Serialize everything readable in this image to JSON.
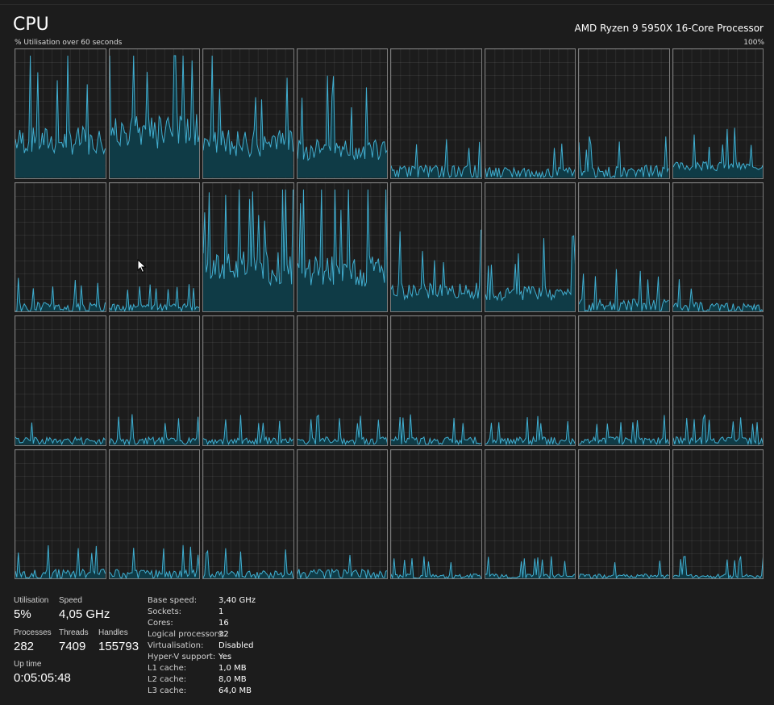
{
  "header": {
    "title": "CPU",
    "processor": "AMD Ryzen 9 5950X 16-Core Processor",
    "graph_label": "% Utilisation over 60 seconds",
    "graph_max": "100%"
  },
  "colors": {
    "background": "#1c1c1c",
    "graph_line": "#41aed0",
    "graph_fill": "#0f3b46",
    "graph_border": "#7b7b7b"
  },
  "cpu_graphs": [
    {
      "level": 0.32
    },
    {
      "level": 0.4
    },
    {
      "level": 0.3
    },
    {
      "level": 0.25
    },
    {
      "level": 0.08
    },
    {
      "level": 0.07
    },
    {
      "level": 0.08
    },
    {
      "level": 0.1
    },
    {
      "level": 0.06
    },
    {
      "level": 0.05
    },
    {
      "level": 0.38
    },
    {
      "level": 0.35
    },
    {
      "level": 0.18
    },
    {
      "level": 0.16
    },
    {
      "level": 0.08
    },
    {
      "level": 0.06
    },
    {
      "level": 0.05
    },
    {
      "level": 0.05
    },
    {
      "level": 0.05
    },
    {
      "level": 0.05
    },
    {
      "level": 0.05
    },
    {
      "level": 0.05
    },
    {
      "level": 0.05
    },
    {
      "level": 0.05
    },
    {
      "level": 0.06
    },
    {
      "level": 0.06
    },
    {
      "level": 0.05
    },
    {
      "level": 0.06
    },
    {
      "level": 0.03
    },
    {
      "level": 0.03
    },
    {
      "level": 0.03
    },
    {
      "level": 0.03
    }
  ],
  "stats": {
    "utilisation": {
      "label": "Utilisation",
      "value": "5%"
    },
    "speed": {
      "label": "Speed",
      "value": "4,05 GHz"
    },
    "processes": {
      "label": "Processes",
      "value": "282"
    },
    "threads": {
      "label": "Threads",
      "value": "7409"
    },
    "handles": {
      "label": "Handles",
      "value": "155793"
    },
    "uptime": {
      "label": "Up time",
      "value": "0:05:05:48"
    }
  },
  "specs": [
    {
      "label": "Base speed:",
      "value": "3,40 GHz"
    },
    {
      "label": "Sockets:",
      "value": "1"
    },
    {
      "label": "Cores:",
      "value": "16"
    },
    {
      "label": "Logical processors:",
      "value": "32"
    },
    {
      "label": "Virtualisation:",
      "value": "Disabled"
    },
    {
      "label": "Hyper-V support:",
      "value": "Yes"
    },
    {
      "label": "L1 cache:",
      "value": "1,0 MB"
    },
    {
      "label": "L2 cache:",
      "value": "8,0 MB"
    },
    {
      "label": "L3 cache:",
      "value": "64,0 MB"
    }
  ]
}
